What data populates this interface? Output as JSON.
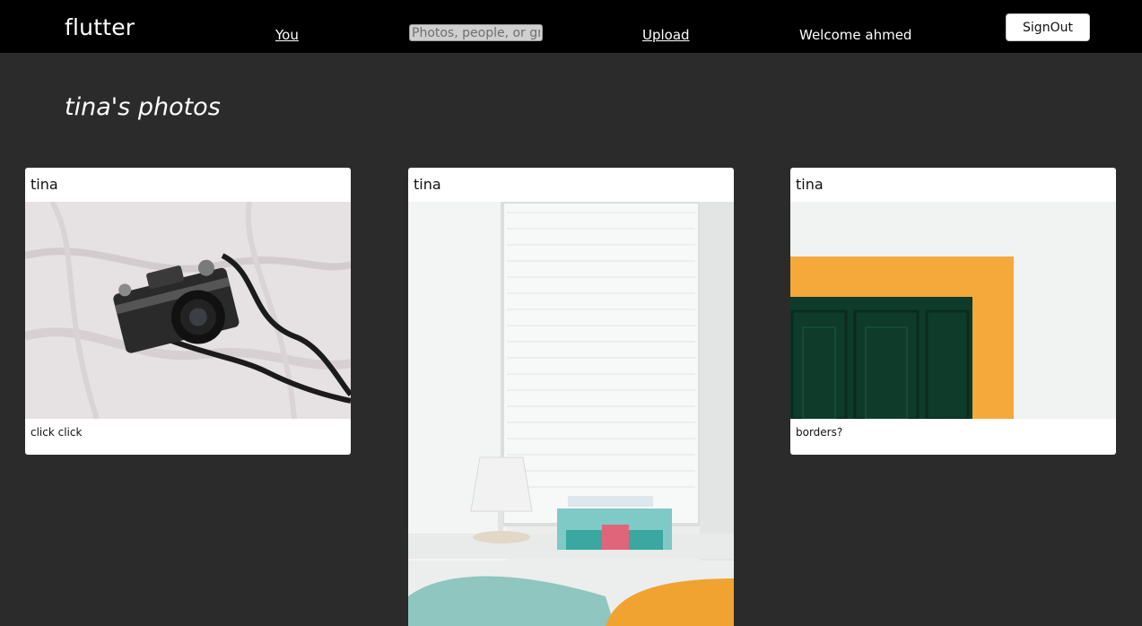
{
  "header": {
    "brand": "flutter",
    "nav_you": "You",
    "search_placeholder": "Photos, people, or groups",
    "nav_upload": "Upload",
    "welcome": "Welcome ahmed",
    "signout": "SignOut"
  },
  "page": {
    "title": "tina's photos"
  },
  "photos": [
    {
      "owner": "tina",
      "caption": "click click",
      "image": "camera-on-bed-photo"
    },
    {
      "owner": "tina",
      "caption": "",
      "image": "window-blinds-room-photo"
    },
    {
      "owner": "tina",
      "caption": "borders?",
      "image": "green-door-orange-frame-photo"
    }
  ],
  "colors": {
    "topbar": "#000000",
    "background": "#2b2b2b",
    "card": "#ffffff",
    "frame_orange": "#f5a93b",
    "door_green": "#0f3b2b"
  }
}
